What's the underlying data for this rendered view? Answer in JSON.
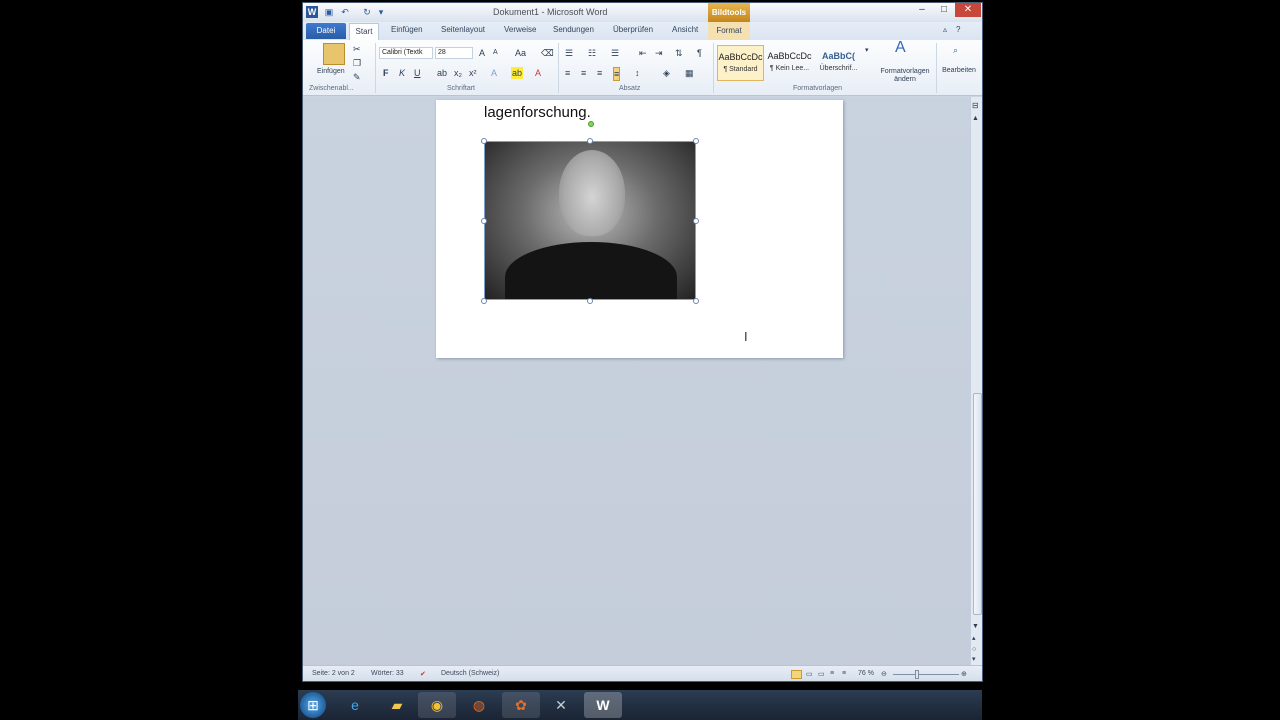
{
  "window": {
    "title": "Dokument1 - Microsoft Word",
    "contextual_tab_group": "Bildtools"
  },
  "tabs": [
    "Datei",
    "Start",
    "Einfügen",
    "Seitenlayout",
    "Verweise",
    "Sendungen",
    "Überprüfen",
    "Ansicht",
    "Format"
  ],
  "ribbon": {
    "clipboard": {
      "paste_label": "Einfügen",
      "group_label": "Zwischenabl..."
    },
    "font": {
      "font_name": "Calibri (Textk",
      "font_size": "28",
      "group_label": "Schriftart",
      "bold": "F",
      "italic": "K",
      "underline": "U"
    },
    "paragraph": {
      "group_label": "Absatz"
    },
    "styles": {
      "items": [
        {
          "sample": "AaBbCcDc",
          "name": "¶ Standard"
        },
        {
          "sample": "AaBbCcDc",
          "name": "¶ Kein Lee..."
        },
        {
          "sample": "AaBbC(",
          "name": "Überschrif..."
        }
      ],
      "change_label_line1": "Formatvorlagen",
      "change_label_line2": "ändern",
      "group_label": "Formatvorlagen"
    },
    "editing": {
      "label": "Bearbeiten"
    }
  },
  "document": {
    "text": "lagenforschung."
  },
  "status_bar": {
    "page": "Seite: 2 von 2",
    "words": "Wörter: 33",
    "language": "Deutsch (Schweiz)",
    "zoom": "76 %"
  },
  "colors": {
    "accent": "#2a5ca6",
    "contextual": "#d89a2c"
  }
}
